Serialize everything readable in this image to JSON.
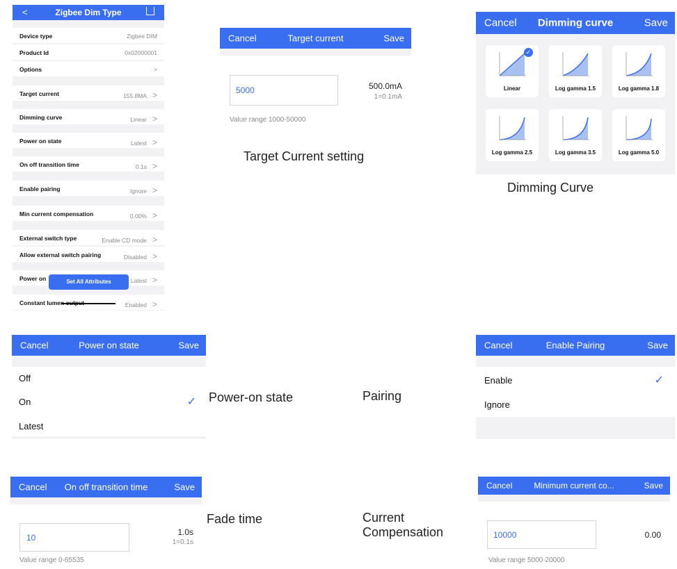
{
  "settings": {
    "title": "Zigbee Dim Type",
    "rows": [
      {
        "label": "Device type",
        "value": "Zigbee DIM"
      },
      {
        "label": "Product Id",
        "value": "0x02000001"
      },
      {
        "label": "Options",
        "value": ""
      },
      {
        "label": "Target current",
        "value": "155.8MA"
      },
      {
        "label": "Dimming curve",
        "value": "Linear"
      },
      {
        "label": "Power on state",
        "value": "Latest"
      },
      {
        "label": "On off transition time",
        "value": "0.1s"
      },
      {
        "label": "Enable pairing",
        "value": "Ignore"
      },
      {
        "label": "Min current compensation",
        "value": "0.00%"
      },
      {
        "label": "External switch type",
        "value": "Enable CD mode"
      },
      {
        "label": "Allow external switch pairing",
        "value": "Disabled"
      },
      {
        "label": "Power on",
        "value": "Latest"
      },
      {
        "label": "Constant lumen output",
        "value": "Enabled"
      }
    ],
    "set_all_label": "Set All Attributes"
  },
  "target_current": {
    "cancel": "Cancel",
    "title": "Target current",
    "save": "Save",
    "value": "5000",
    "display": "500.0mA",
    "unit_note": "1=0.1mA",
    "range": "Value range 1000-50000"
  },
  "dimming_curve": {
    "cancel": "Cancel",
    "title": "Dimming curve",
    "save": "Save",
    "options": [
      "Linear",
      "Log gamma 1.5",
      "Log gamma 1.8",
      "Log gamma 2.5",
      "Log gamma 3.5",
      "Log gamma 5.0"
    ],
    "selected": "Linear"
  },
  "power_on_state": {
    "cancel": "Cancel",
    "title": "Power on state",
    "save": "Save",
    "options": [
      "Off",
      "On",
      "Latest"
    ],
    "selected": "On"
  },
  "enable_pairing": {
    "cancel": "Cancel",
    "title": "Enable Pairing",
    "save": "Save",
    "options": [
      "Enable",
      "Ignore"
    ],
    "selected": "Enable"
  },
  "transition_time": {
    "cancel": "Cancel",
    "title": "On off transition time",
    "save": "Save",
    "value": "10",
    "display": "1.0s",
    "unit_note": "1=0.1s",
    "range": "Value range 0-65535"
  },
  "min_current": {
    "cancel": "Cancel",
    "title": "Minimum current co...",
    "save": "Save",
    "value": "10000",
    "display": "0.00",
    "range": "Value range 5000-20000"
  },
  "captions": {
    "target_current": "Target Current setting",
    "dimming_curve": "Dimming Curve",
    "power_on": "Power-on state",
    "pairing": "Pairing",
    "fade": "Fade time",
    "compensation_1": "Current",
    "compensation_2": "Compensation"
  },
  "colors": {
    "accent": "#3a6ef0",
    "background_grey": "#f2f2f4"
  }
}
